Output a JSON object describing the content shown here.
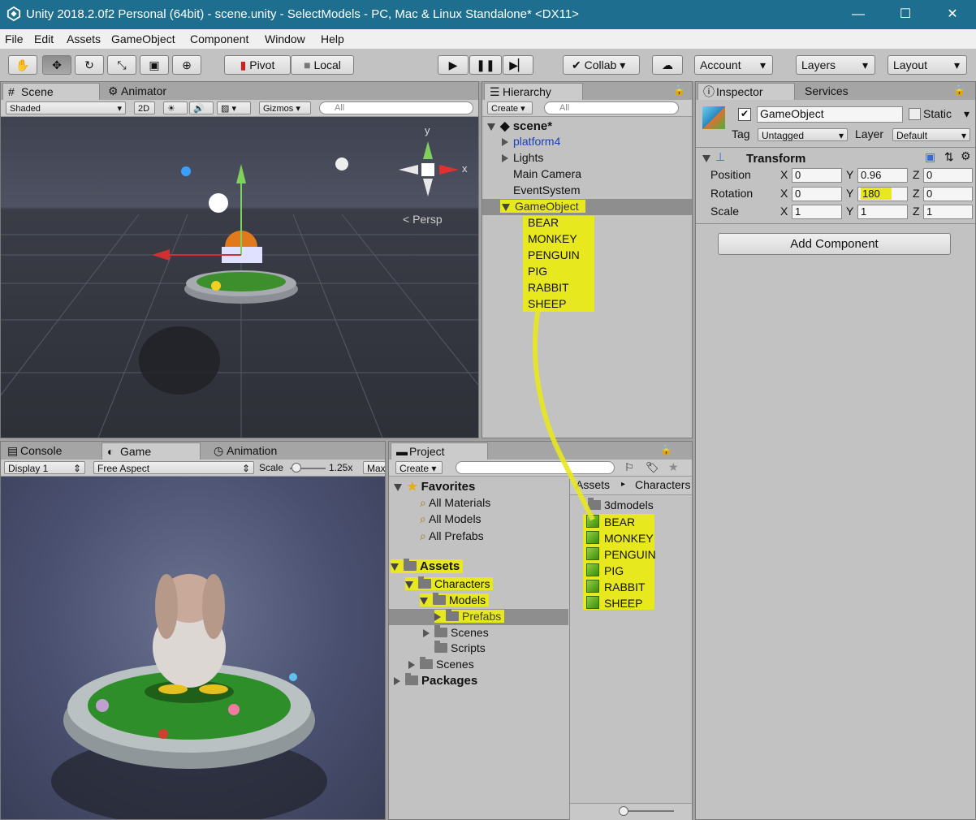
{
  "window": {
    "title": "Unity 2018.2.0f2 Personal (64bit) - scene.unity - SelectModels - PC, Mac & Linux Standalone* <DX11>"
  },
  "menu": [
    "File",
    "Edit",
    "Assets",
    "GameObject",
    "Component",
    "Window",
    "Help"
  ],
  "toolbar": {
    "pivot": "Pivot",
    "local": "Local",
    "collab": "Collab",
    "account": "Account",
    "layers": "Layers",
    "layout": "Layout"
  },
  "scene_panel": {
    "tabs": [
      "Scene",
      "Animator"
    ],
    "shading": "Shaded",
    "mode2d": "2D",
    "gizmos": "Gizmos",
    "search_placeholder": "All",
    "axis_y": "y",
    "axis_x": "x",
    "persp": "Persp"
  },
  "game_panel": {
    "tabs": [
      "Console",
      "Game",
      "Animation"
    ],
    "display": "Display 1",
    "aspect": "Free Aspect",
    "scale_label": "Scale",
    "scale_value": "1.25x",
    "max_label": "Max"
  },
  "hierarchy": {
    "tab": "Hierarchy",
    "create": "Create",
    "search_placeholder": "All",
    "scene": "scene*",
    "items": [
      "platform4",
      "Lights",
      "Main Camera",
      "EventSystem",
      "GameObject"
    ],
    "children": [
      "BEAR",
      "MONKEY",
      "PENGUIN",
      "PIG",
      "RABBIT",
      "SHEEP"
    ]
  },
  "project": {
    "tab": "Project",
    "create": "Create",
    "favorites": "Favorites",
    "fav_items": [
      "All Materials",
      "All Models",
      "All Prefabs"
    ],
    "assets": "Assets",
    "characters": "Characters",
    "models": "Models",
    "prefabs": "Prefabs",
    "char_scenes": "Scenes",
    "char_scripts": "Scripts",
    "scenes": "Scenes",
    "packages": "Packages",
    "breadcrumb": [
      "Assets",
      "Characters"
    ],
    "folder_3d": "3dmodels",
    "prefab_items": [
      "BEAR",
      "MONKEY",
      "PENGUIN",
      "PIG",
      "RABBIT",
      "SHEEP"
    ]
  },
  "inspector": {
    "tabs": [
      "Inspector",
      "Services"
    ],
    "name": "GameObject",
    "static": "Static",
    "tag_label": "Tag",
    "tag_value": "Untagged",
    "layer_label": "Layer",
    "layer_value": "Default",
    "transform": "Transform",
    "position_label": "Position",
    "rotation_label": "Rotation",
    "scale_label": "Scale",
    "x": "X",
    "y": "Y",
    "z": "Z",
    "position": [
      "0",
      "0.96",
      "0"
    ],
    "rotation": [
      "0",
      "180",
      "0"
    ],
    "scale": [
      "1",
      "1",
      "1"
    ],
    "add_component": "Add Component"
  },
  "colors": {
    "titlebar": "#1e6f8f",
    "highlight": "#e8e81e",
    "editor_bg": "#c2c2c2"
  }
}
